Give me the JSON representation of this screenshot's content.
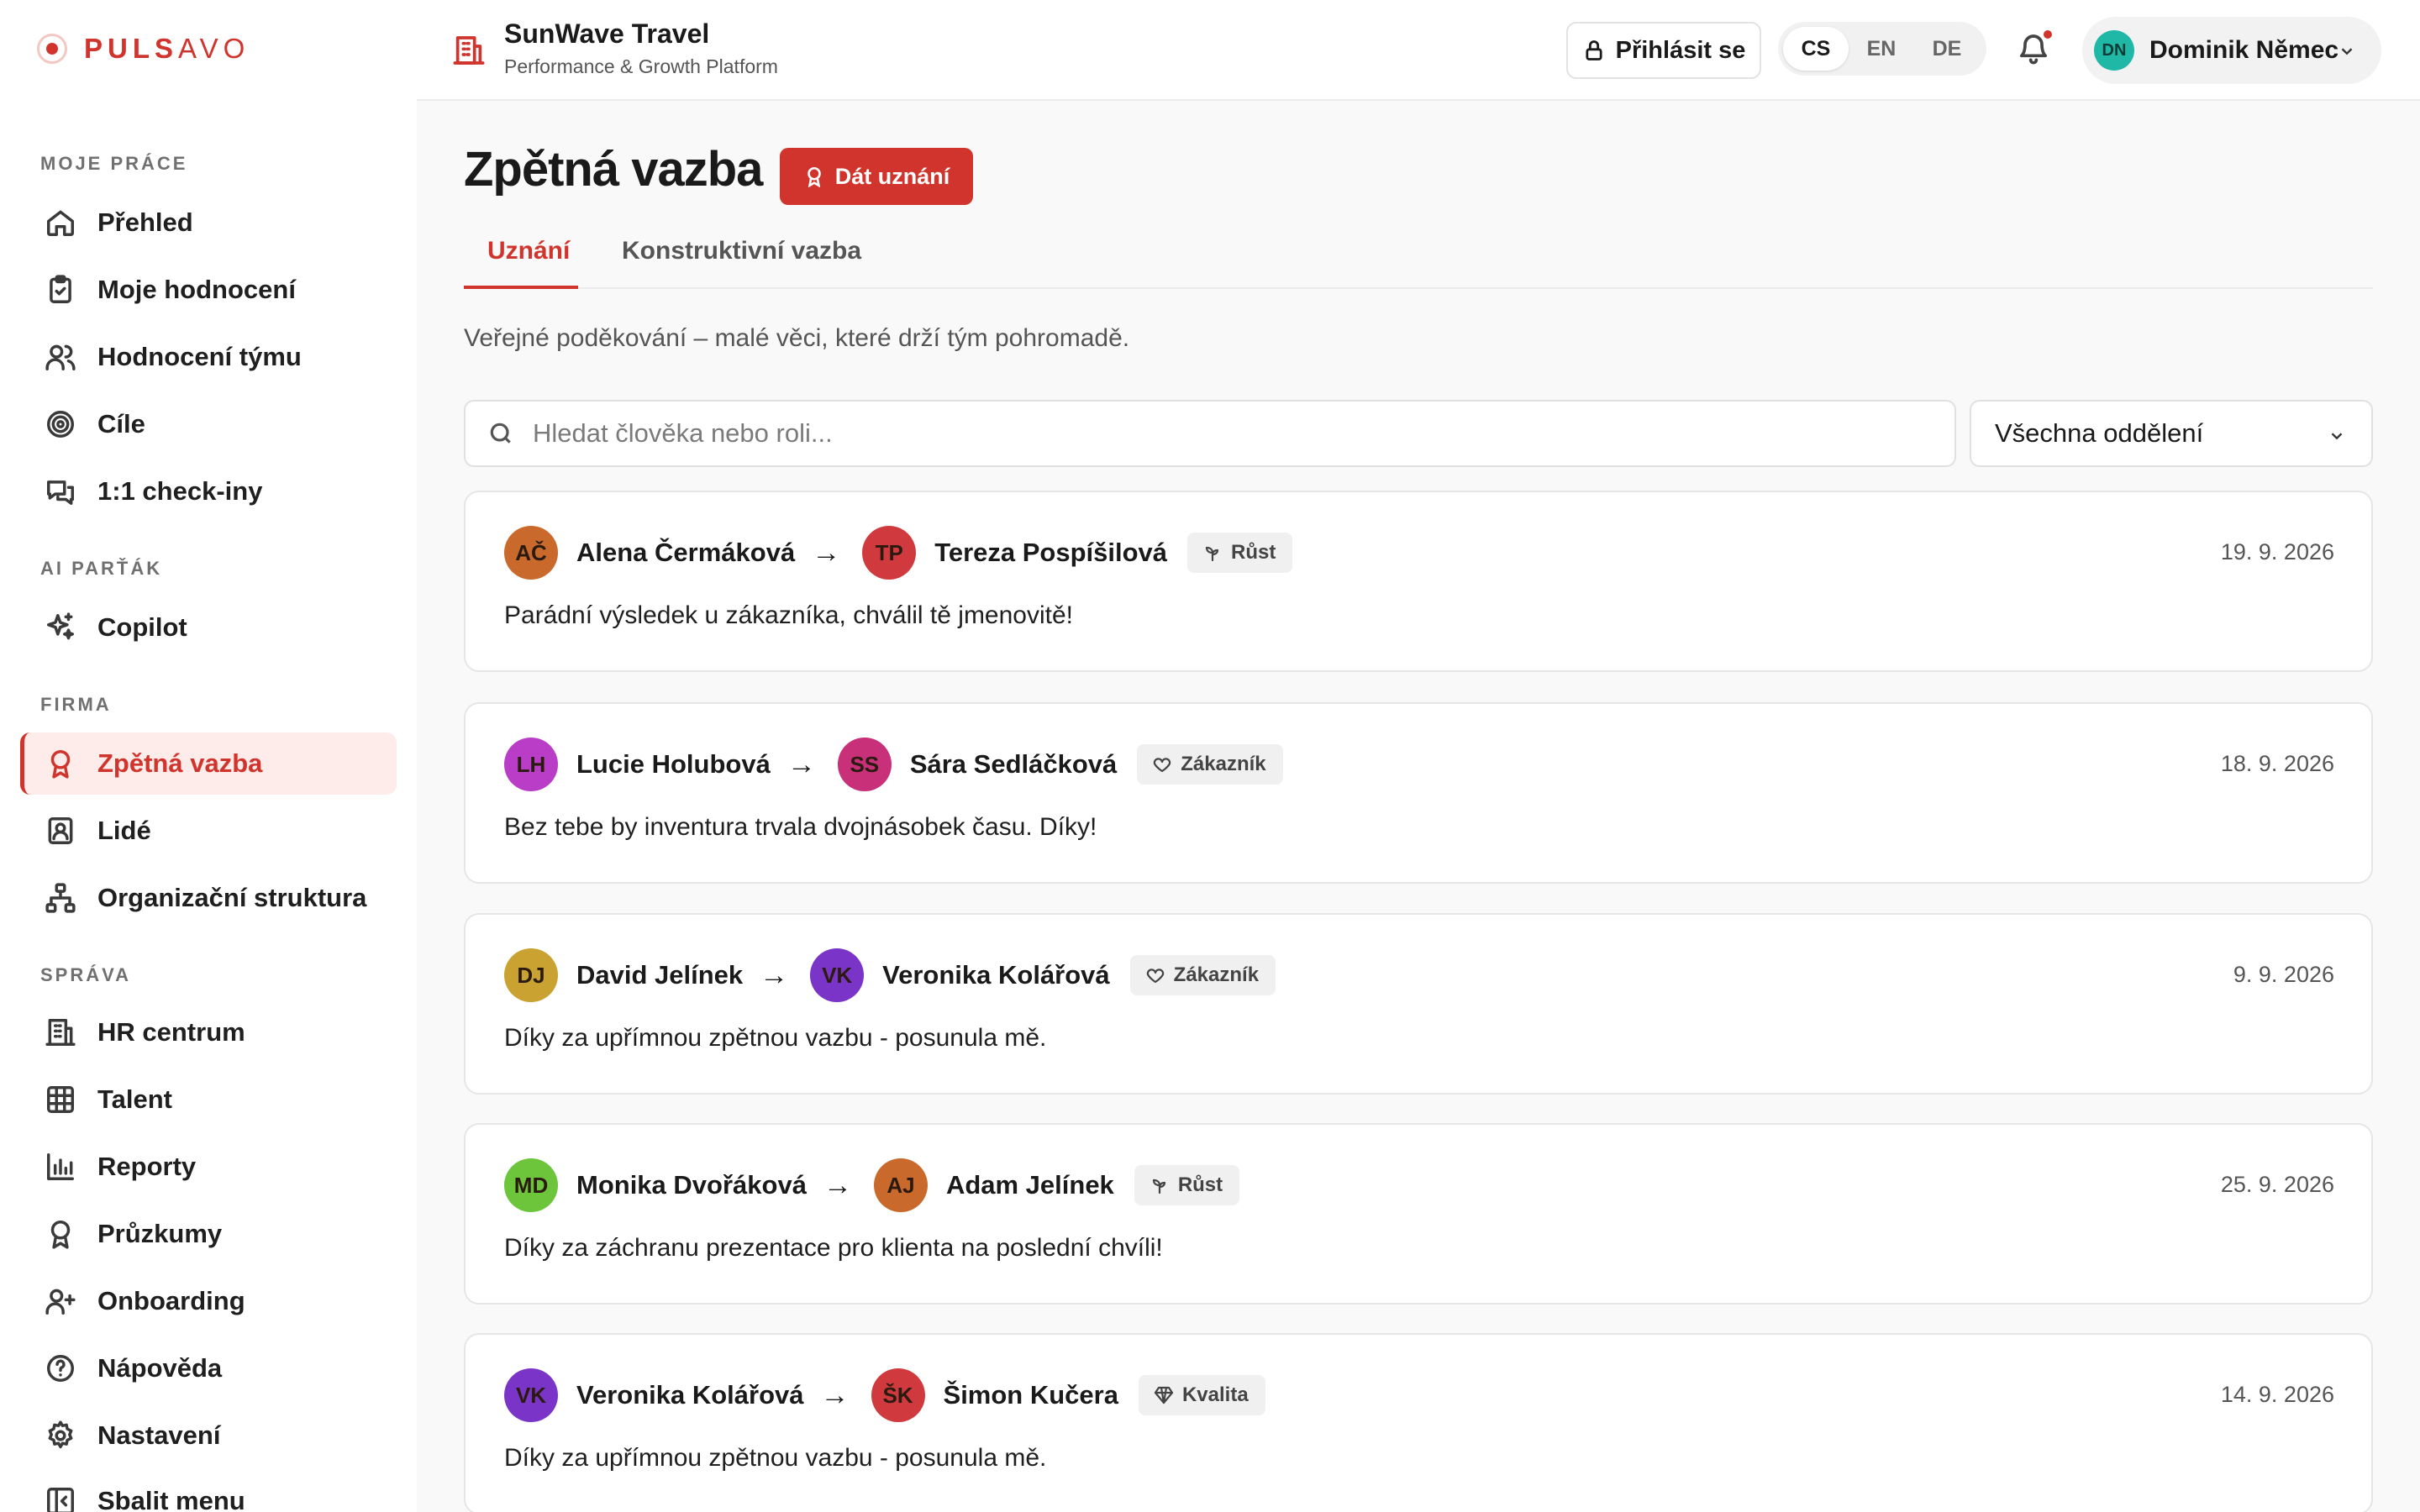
{
  "brand": {
    "name_bold": "PULS",
    "name_light": "AVO",
    "accent": "#d0342c"
  },
  "sidebar": {
    "sections": [
      {
        "label": "MOJE PRÁCE",
        "items": [
          {
            "label": "Přehled",
            "icon": "home-icon"
          },
          {
            "label": "Moje hodnocení",
            "icon": "clipboard-icon"
          },
          {
            "label": "Hodnocení týmu",
            "icon": "users-icon"
          },
          {
            "label": "Cíle",
            "icon": "target-icon"
          },
          {
            "label": "1:1 check-iny",
            "icon": "chat-icon"
          }
        ]
      },
      {
        "label": "AI PARŤÁK",
        "items": [
          {
            "label": "Copilot",
            "icon": "sparkles-icon"
          }
        ]
      },
      {
        "label": "FIRMA",
        "items": [
          {
            "label": "Zpětná vazba",
            "icon": "award-icon",
            "active": true
          },
          {
            "label": "Lidé",
            "icon": "id-badge-icon"
          },
          {
            "label": "Organizační struktura",
            "icon": "org-chart-icon"
          }
        ]
      },
      {
        "label": "SPRÁVA",
        "items": [
          {
            "label": "HR centrum",
            "icon": "building-icon"
          },
          {
            "label": "Talent",
            "icon": "grid-icon"
          },
          {
            "label": "Reporty",
            "icon": "bar-chart-icon"
          },
          {
            "label": "Průzkumy",
            "icon": "award-icon"
          },
          {
            "label": "Onboarding",
            "icon": "user-plus-icon"
          },
          {
            "label": "Nápověda",
            "icon": "help-icon"
          },
          {
            "label": "Nastavení",
            "icon": "gear-icon"
          }
        ]
      }
    ],
    "collapse_label": "Sbalit menu"
  },
  "header": {
    "company": "SunWave Travel",
    "company_sub": "Performance & Growth Platform",
    "login_label": "Přihlásit se",
    "languages": [
      "CS",
      "EN",
      "DE"
    ],
    "active_language": "CS",
    "user_initials": "DN",
    "user_name": "Dominik Němec"
  },
  "main": {
    "title": "Zpětná vazba",
    "give_button": "Dát uznání",
    "tabs": [
      {
        "label": "Uznání",
        "active": true
      },
      {
        "label": "Konstruktivní vazba",
        "active": false
      }
    ],
    "subtitle": "Veřejné poděkování – malé věci, které drží tým pohromadě.",
    "search_placeholder": "Hledat člověka nebo roli...",
    "department_filter": "Všechna oddělení",
    "cards": [
      {
        "from": {
          "initials": "AČ",
          "name": "Alena Čermáková",
          "color": "#c96a2c"
        },
        "to": {
          "initials": "TP",
          "name": "Tereza Pospíšilová",
          "color": "#d03a3e"
        },
        "tag": "Růst",
        "tag_icon": "sprout-icon",
        "date": "19. 9. 2026",
        "message": "Parádní výsledek u zákazníka, chválil tě jmenovitě!"
      },
      {
        "from": {
          "initials": "LH",
          "name": "Lucie Holubová",
          "color": "#b93dc6"
        },
        "to": {
          "initials": "SS",
          "name": "Sára Sedláčková",
          "color": "#c9307a"
        },
        "tag": "Zákazník",
        "tag_icon": "heart-icon",
        "date": "18. 9. 2026",
        "message": "Bez tebe by inventura trvala dvojnásobek času. Díky!"
      },
      {
        "from": {
          "initials": "DJ",
          "name": "David Jelínek",
          "color": "#c9a232"
        },
        "to": {
          "initials": "VK",
          "name": "Veronika Kolářová",
          "color": "#7a35c8"
        },
        "tag": "Zákazník",
        "tag_icon": "heart-icon",
        "date": "9. 9. 2026",
        "message": "Díky za upřímnou zpětnou vazbu - posunula mě."
      },
      {
        "from": {
          "initials": "MD",
          "name": "Monika Dvořáková",
          "color": "#6cc53a"
        },
        "to": {
          "initials": "AJ",
          "name": "Adam Jelínek",
          "color": "#c96a2c"
        },
        "tag": "Růst",
        "tag_icon": "sprout-icon",
        "date": "25. 9. 2026",
        "message": "Díky za záchranu prezentace pro klienta na poslední chvíli!"
      },
      {
        "from": {
          "initials": "VK",
          "name": "Veronika Kolářová",
          "color": "#7a35c8"
        },
        "to": {
          "initials": "ŠK",
          "name": "Šimon Kučera",
          "color": "#d03a3e"
        },
        "tag": "Kvalita",
        "tag_icon": "diamond-icon",
        "date": "14. 9. 2026",
        "message": "Díky za upřímnou zpětnou vazbu - posunula mě."
      }
    ]
  }
}
